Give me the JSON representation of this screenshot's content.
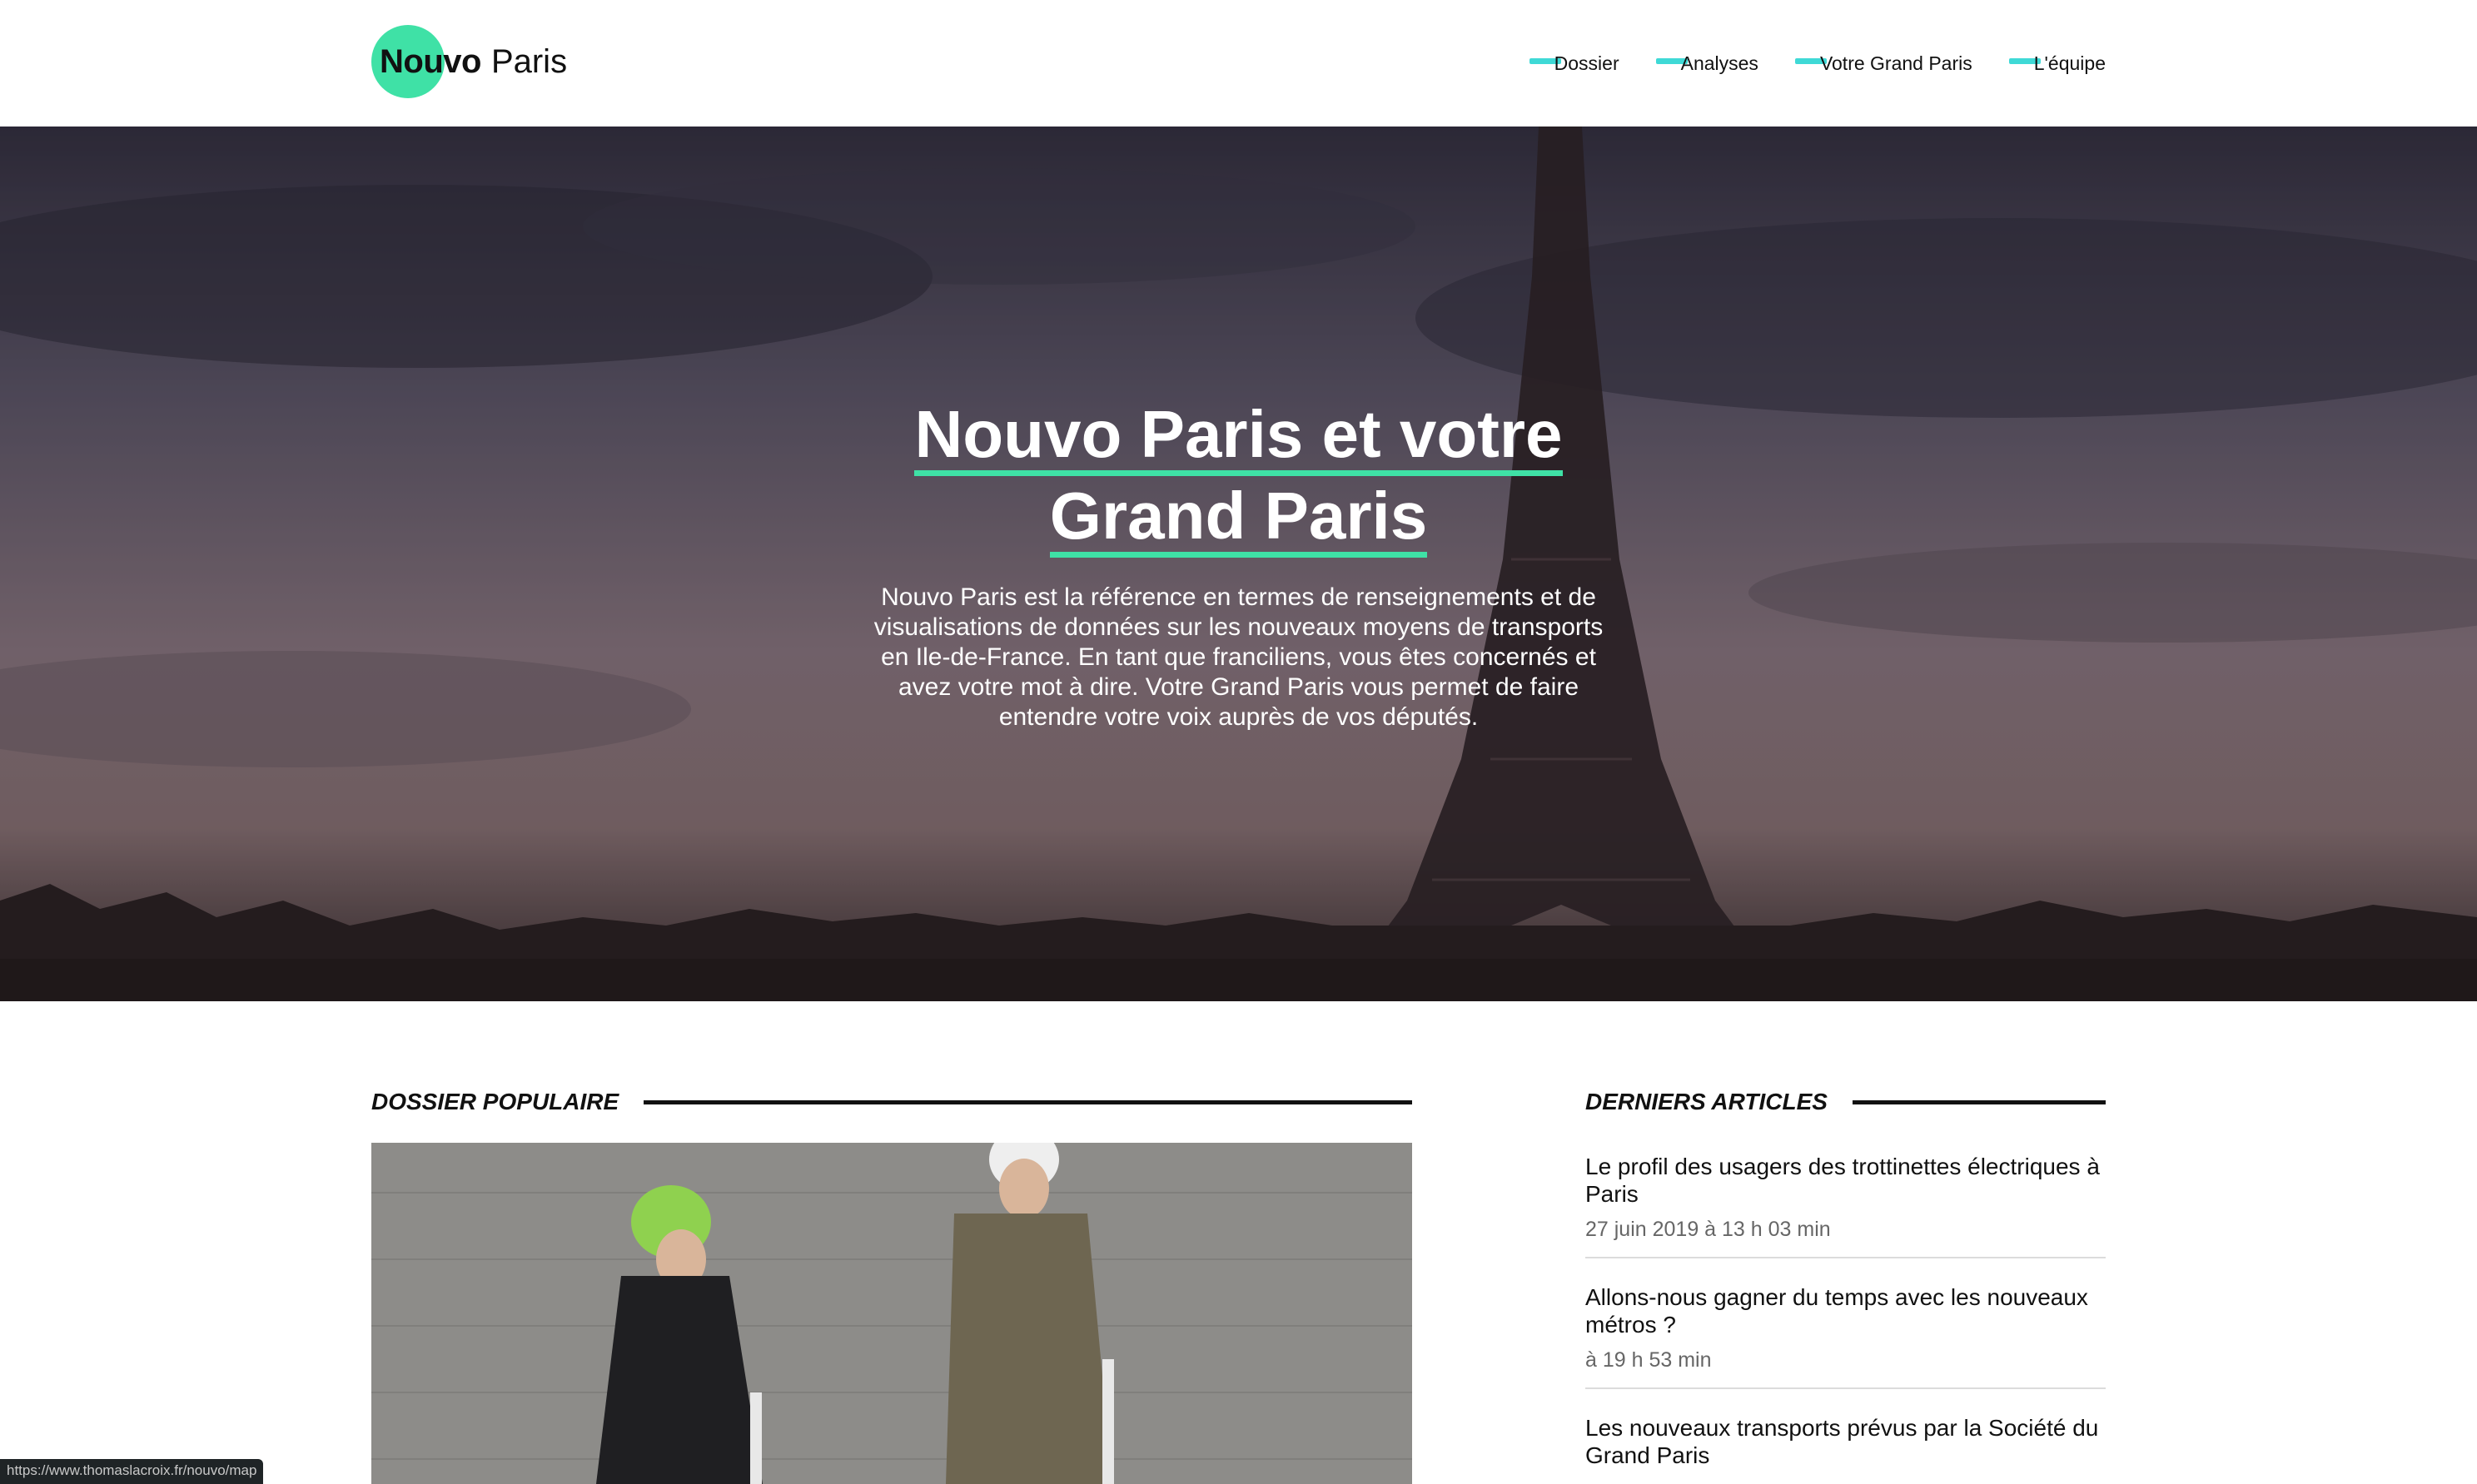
{
  "colors": {
    "accent": "#3fe1a6",
    "nav_dash": "#3fd9d6",
    "dark": "#111111"
  },
  "logo": {
    "bold": "Nouvo",
    "light": "Paris"
  },
  "nav": {
    "items": [
      {
        "label": "Dossier"
      },
      {
        "label": "Analyses"
      },
      {
        "label": "Votre Grand Paris"
      },
      {
        "label": "L'équipe"
      }
    ]
  },
  "hero": {
    "title_line1": "Nouvo Paris et votre",
    "title_line2": "Grand Paris",
    "description": "Nouvo Paris est la référence en termes de renseignements et de visualisations de données sur les nouveaux moyens de transports en Ile-de-France. En tant que franciliens, vous êtes concernés et avez votre mot à dire. Votre Grand Paris vous permet de faire entendre votre voix auprès de vos députés."
  },
  "sections": {
    "popular": "DOSSIER POPULAIRE",
    "latest": "DERNIERS ARTICLES"
  },
  "articles": [
    {
      "title": "Le profil des usagers des trottinettes électriques à Paris",
      "date": "27 juin 2019 à 13 h 03 min"
    },
    {
      "title": "Allons-nous gagner du temps avec les nouveaux métros ?",
      "date": "à 19 h 53 min"
    },
    {
      "title": "Les nouveaux transports prévus par la Société du Grand Paris",
      "date": ""
    }
  ],
  "status_bar": {
    "url": "https://www.thomaslacroix.fr/nouvo/map"
  }
}
